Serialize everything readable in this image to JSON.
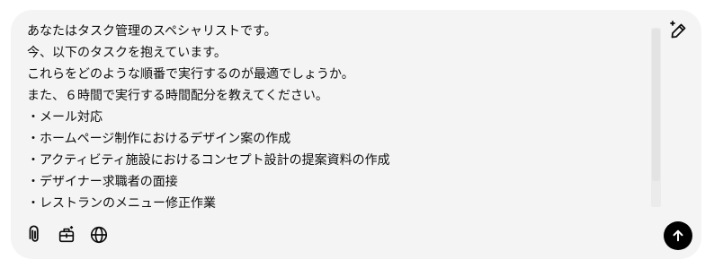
{
  "composer": {
    "lines": [
      "あなたはタスク管理のスペシャリストです。",
      "今、以下のタスクを抱えています。",
      "これらをどのような順番で実行するのが最適でしょうか。",
      "また、６時間で実行する時間配分を教えてください。",
      "・メール対応",
      "・ホームページ制作におけるデザイン案の作成",
      "・アクティビティ施設におけるコンセプト設計の提案資料の作成",
      "・デザイナー求職者の面接",
      "・レストランのメニュー修正作業"
    ]
  },
  "icons": {
    "edit": "pen-sparkle-icon",
    "attach": "paperclip-icon",
    "tools": "toolbox-icon",
    "web": "globe-icon",
    "send": "arrow-up-icon"
  },
  "colors": {
    "composer_bg": "#f4f4f4",
    "text": "#0d0d0d",
    "send_bg": "#000000",
    "send_icon": "#ffffff"
  }
}
